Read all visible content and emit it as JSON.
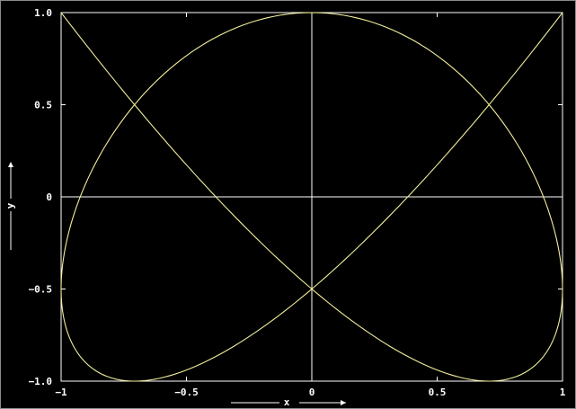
{
  "chart_data": {
    "type": "line",
    "xlabel": "x",
    "ylabel": "y",
    "xlim": [
      -1,
      1
    ],
    "ylim": [
      -1,
      1
    ],
    "x_ticks": [
      {
        "value": -1,
        "label": "−1"
      },
      {
        "value": -0.5,
        "label": "−0.5"
      },
      {
        "value": 0,
        "label": "0"
      },
      {
        "value": 0.5,
        "label": "0.5"
      },
      {
        "value": 1,
        "label": "1"
      }
    ],
    "y_ticks": [
      {
        "value": 1,
        "label": "1.0"
      },
      {
        "value": 0.5,
        "label": "0.5"
      },
      {
        "value": 0,
        "label": "0"
      },
      {
        "value": -0.5,
        "label": "−0.5"
      },
      {
        "value": -1,
        "label": "−1.0"
      }
    ],
    "zero_lines": true,
    "series": [
      {
        "curve": "parametric",
        "x_expression": "sin(3t)",
        "y_expression": "cos(4t)",
        "t_range": [
          0,
          6.283185307
        ],
        "samples": 1200
      }
    ],
    "colors": {
      "background": "#000000",
      "curve": "#f2ee9a",
      "axes": "#ffffff",
      "text": "#ffffff"
    }
  }
}
